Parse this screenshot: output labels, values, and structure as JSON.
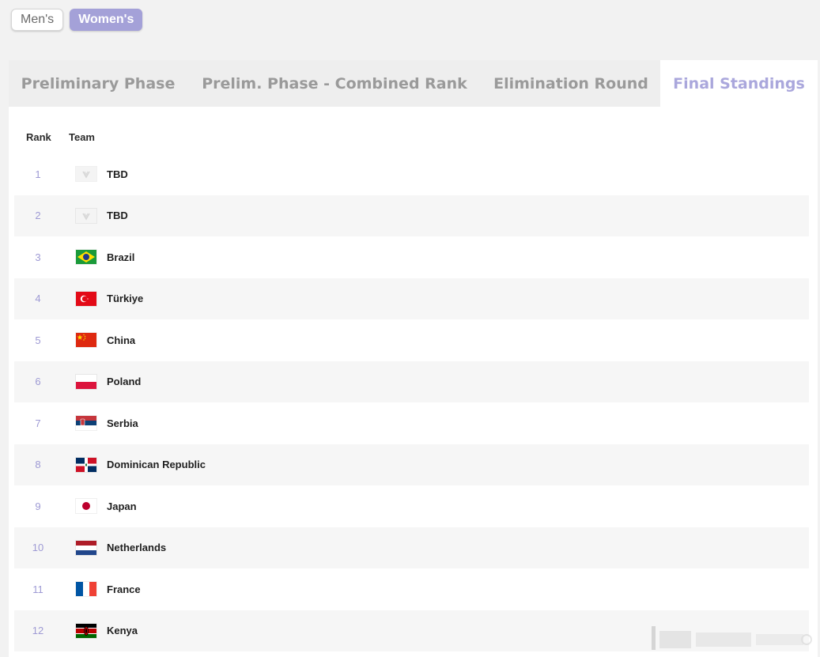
{
  "gender_toggle": {
    "men_label": "Men's",
    "women_label": "Women's",
    "selected": "Women's"
  },
  "tabs": [
    {
      "label": "Preliminary Phase",
      "active": false
    },
    {
      "label": "Prelim. Phase - Combined Rank",
      "active": false
    },
    {
      "label": "Elimination Round",
      "active": false
    },
    {
      "label": "Final Standings",
      "active": true
    }
  ],
  "table": {
    "headers": {
      "rank": "Rank",
      "team": "Team"
    },
    "rows": [
      {
        "rank": "1",
        "team": "TBD",
        "flag_icon": "placeholder-flag-icon"
      },
      {
        "rank": "2",
        "team": "TBD",
        "flag_icon": "placeholder-flag-icon"
      },
      {
        "rank": "3",
        "team": "Brazil",
        "flag_icon": "brazil-flag-icon"
      },
      {
        "rank": "4",
        "team": "Türkiye",
        "flag_icon": "turkiye-flag-icon"
      },
      {
        "rank": "5",
        "team": "China",
        "flag_icon": "china-flag-icon"
      },
      {
        "rank": "6",
        "team": "Poland",
        "flag_icon": "poland-flag-icon"
      },
      {
        "rank": "7",
        "team": "Serbia",
        "flag_icon": "serbia-flag-icon"
      },
      {
        "rank": "8",
        "team": "Dominican Republic",
        "flag_icon": "dominican-republic-flag-icon"
      },
      {
        "rank": "9",
        "team": "Japan",
        "flag_icon": "japan-flag-icon"
      },
      {
        "rank": "10",
        "team": "Netherlands",
        "flag_icon": "netherlands-flag-icon"
      },
      {
        "rank": "11",
        "team": "France",
        "flag_icon": "france-flag-icon"
      },
      {
        "rank": "12",
        "team": "Kenya",
        "flag_icon": "kenya-flag-icon"
      }
    ]
  },
  "colors": {
    "accent": "#a4a1d8",
    "rank_text": "#9e9ad4",
    "tab_inactive": "#9a9a9a"
  }
}
